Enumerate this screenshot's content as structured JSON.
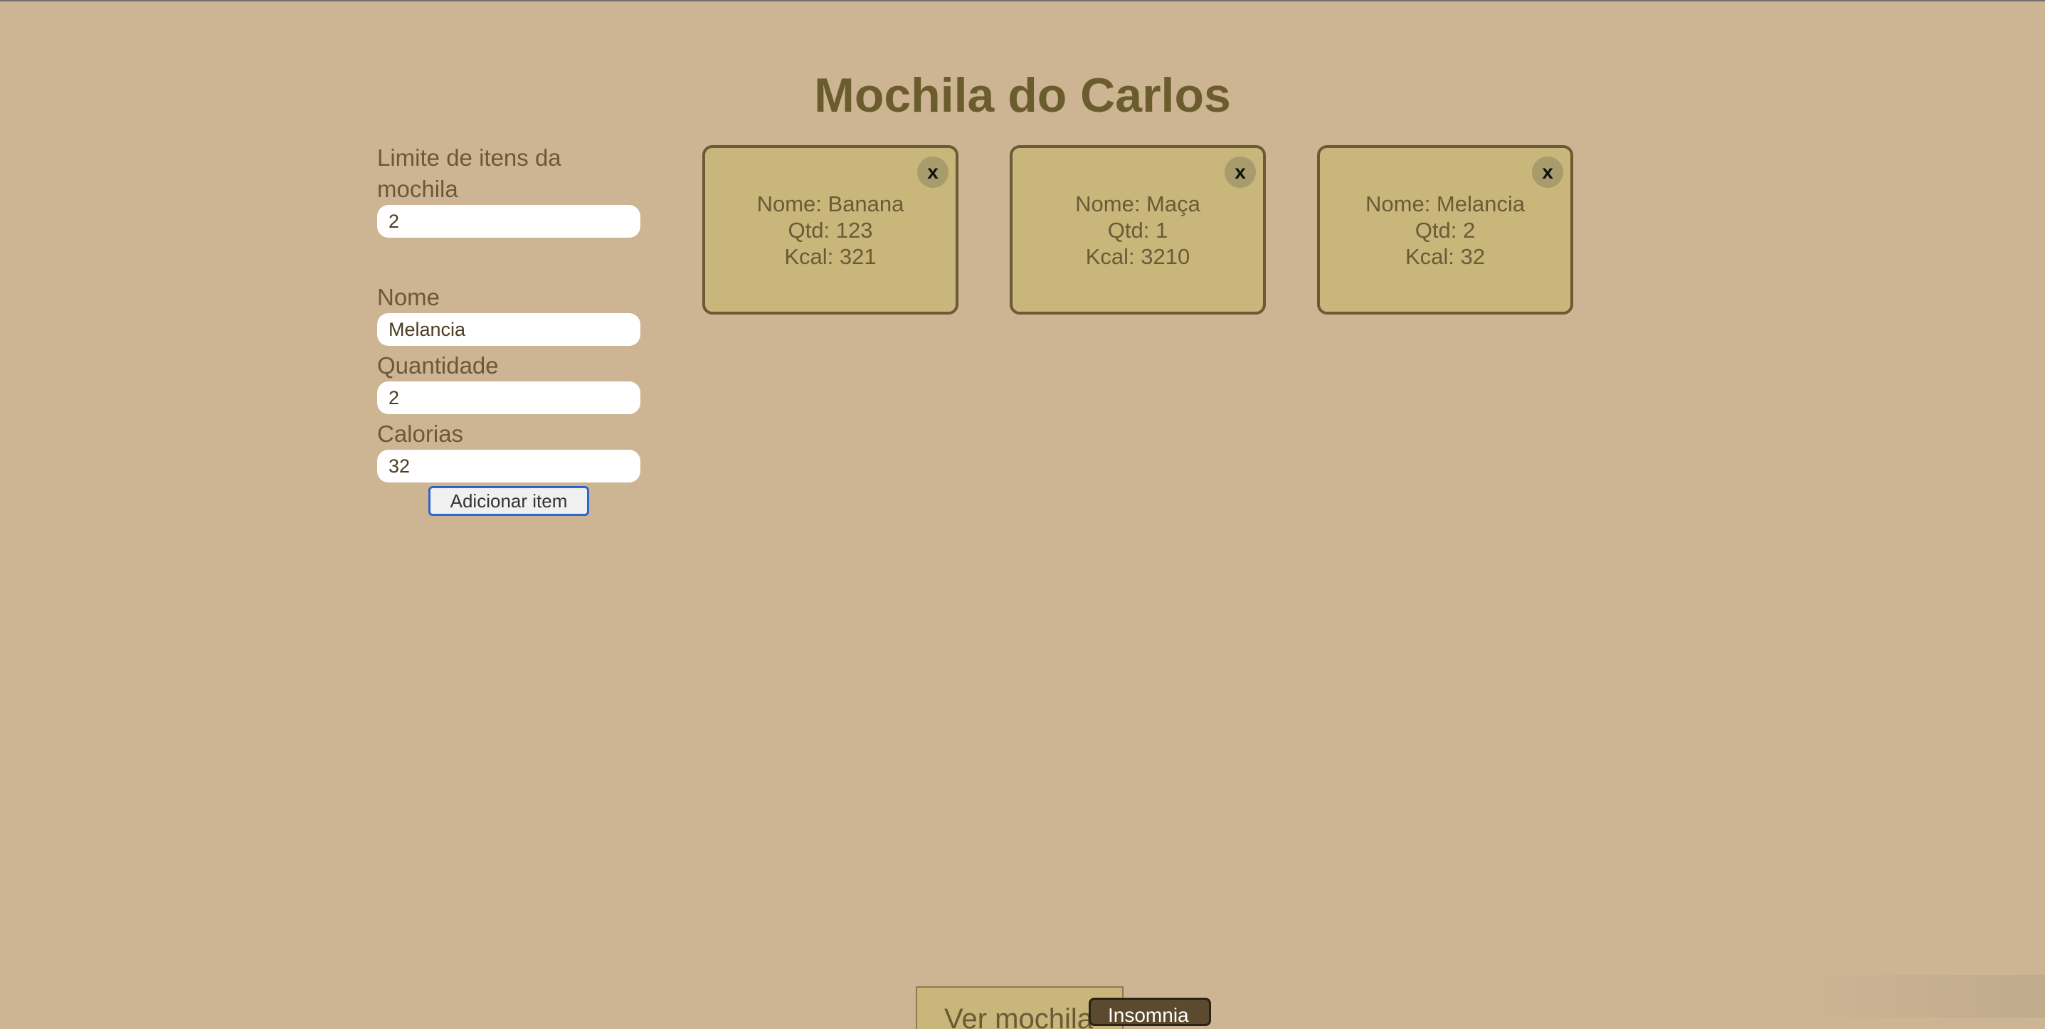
{
  "page": {
    "title": "Mochila do Carlos"
  },
  "form": {
    "limit_label": "Limite de itens da mochila",
    "limit_value": "2",
    "name_label": "Nome",
    "name_value": "Melancia",
    "quantity_label": "Quantidade",
    "quantity_value": "2",
    "calories_label": "Calorias",
    "calories_value": "32",
    "add_button_label": "Adicionar item"
  },
  "items": [
    {
      "close_label": "x",
      "name_line": "Nome: Banana",
      "qty_line": "Qtd: 123",
      "kcal_line": "Kcal: 321"
    },
    {
      "close_label": "x",
      "name_line": "Nome: Maça",
      "qty_line": "Qtd: 1",
      "kcal_line": "Kcal: 3210"
    },
    {
      "close_label": "x",
      "name_line": "Nome: Melancia",
      "qty_line": "Qtd: 2",
      "kcal_line": "Kcal: 32"
    }
  ],
  "footer": {
    "view_backpack_label": "Ver mochila",
    "insomnia_label": "Insomnia"
  },
  "colors": {
    "background": "#cdb593",
    "title": "#6b5c2e",
    "card_fill": "#c8b67a",
    "card_border": "#6b5a35",
    "button_focus_border": "#2c66c8"
  }
}
